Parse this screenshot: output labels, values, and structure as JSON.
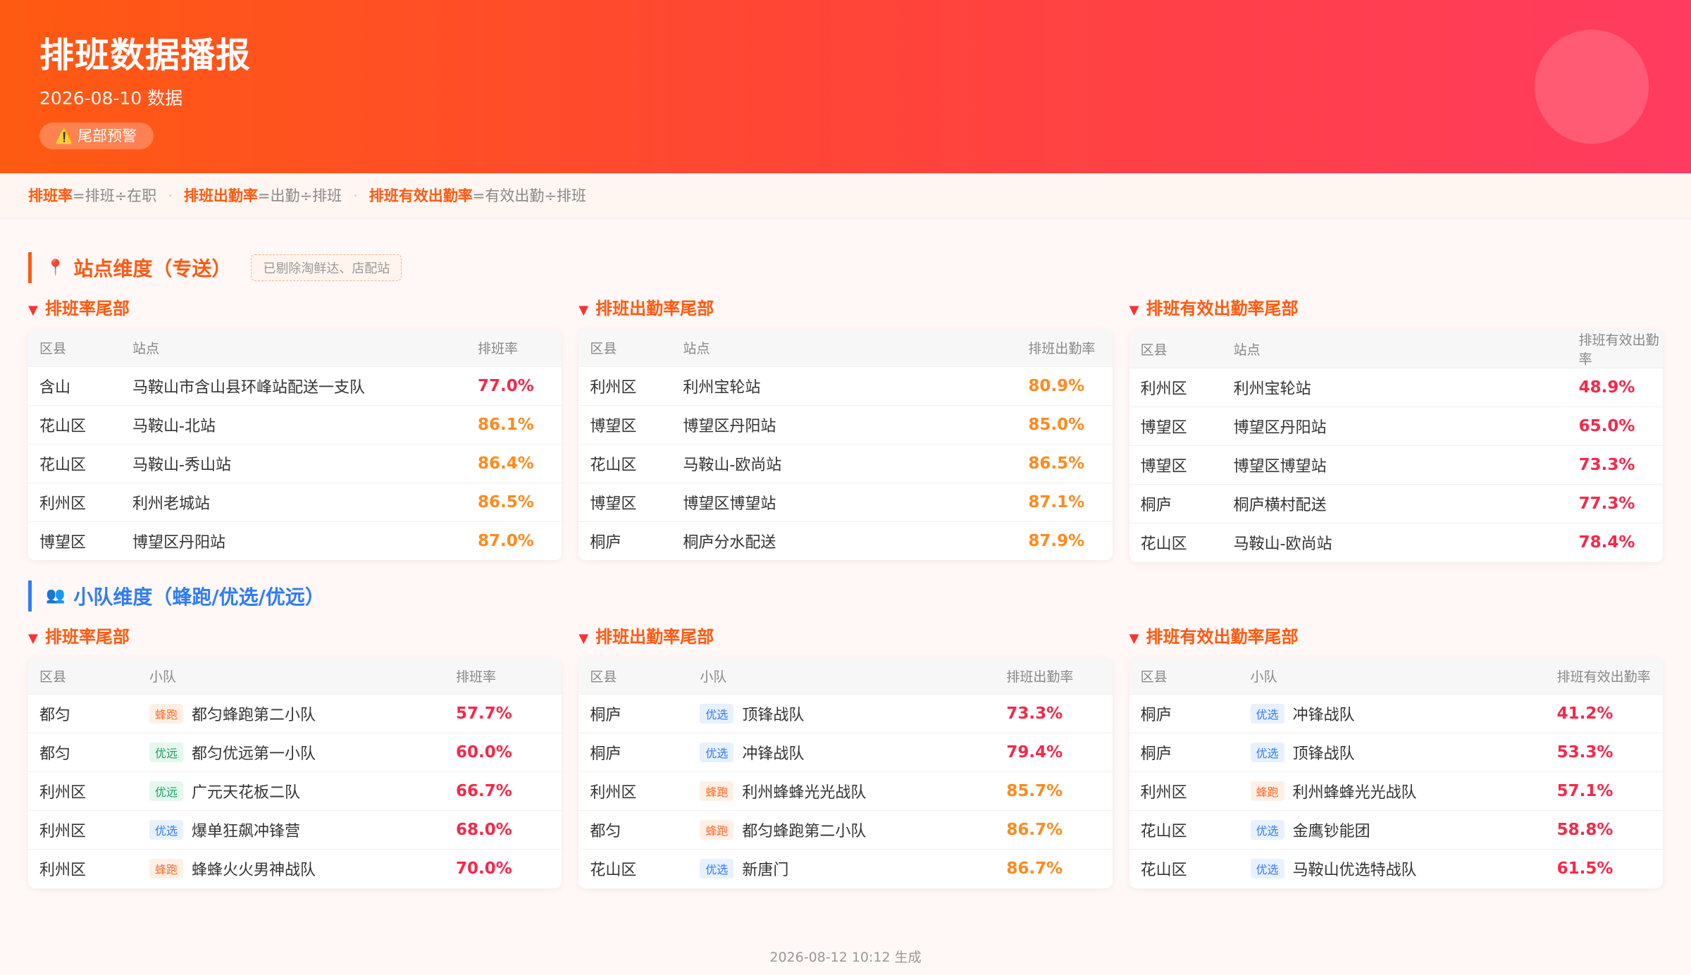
{
  "header": {
    "title": "排班数据播报",
    "date_line": "2026-08-10 数据",
    "warning_badge": "尾部预警"
  },
  "formula": [
    {
      "key": "排班率",
      "expr": "=排班÷在职"
    },
    {
      "key": "排班出勤率",
      "expr": "=出勤÷排班"
    },
    {
      "key": "排班有效出勤率",
      "expr": "=有效出勤÷排班"
    }
  ],
  "station_section": {
    "title": "站点维度（专送）",
    "tag": "已剔除淘鲜达、店配站",
    "tables": [
      {
        "title": "排班率尾部",
        "headers": [
          "区县",
          "站点",
          "排班率"
        ],
        "rows": [
          {
            "district": "含山",
            "name": "马鞍山市含山县环峰站配送一支队",
            "rate": "77.0%",
            "level": "red"
          },
          {
            "district": "花山区",
            "name": "马鞍山-北站",
            "rate": "86.1%",
            "level": "orange"
          },
          {
            "district": "花山区",
            "name": "马鞍山-秀山站",
            "rate": "86.4%",
            "level": "orange"
          },
          {
            "district": "利州区",
            "name": "利州老城站",
            "rate": "86.5%",
            "level": "orange"
          },
          {
            "district": "博望区",
            "name": "博望区丹阳站",
            "rate": "87.0%",
            "level": "orange"
          }
        ]
      },
      {
        "title": "排班出勤率尾部",
        "headers": [
          "区县",
          "站点",
          "排班出勤率"
        ],
        "rows": [
          {
            "district": "利州区",
            "name": "利州宝轮站",
            "rate": "80.9%",
            "level": "orange"
          },
          {
            "district": "博望区",
            "name": "博望区丹阳站",
            "rate": "85.0%",
            "level": "orange"
          },
          {
            "district": "花山区",
            "name": "马鞍山-欧尚站",
            "rate": "86.5%",
            "level": "orange"
          },
          {
            "district": "博望区",
            "name": "博望区博望站",
            "rate": "87.1%",
            "level": "orange"
          },
          {
            "district": "桐庐",
            "name": "桐庐分水配送",
            "rate": "87.9%",
            "level": "orange"
          }
        ]
      },
      {
        "title": "排班有效出勤率尾部",
        "headers": [
          "区县",
          "站点",
          "排班有效出勤率"
        ],
        "rows": [
          {
            "district": "利州区",
            "name": "利州宝轮站",
            "rate": "48.9%",
            "level": "red"
          },
          {
            "district": "博望区",
            "name": "博望区丹阳站",
            "rate": "65.0%",
            "level": "red"
          },
          {
            "district": "博望区",
            "name": "博望区博望站",
            "rate": "73.3%",
            "level": "red"
          },
          {
            "district": "桐庐",
            "name": "桐庐横村配送",
            "rate": "77.3%",
            "level": "red"
          },
          {
            "district": "花山区",
            "name": "马鞍山-欧尚站",
            "rate": "78.4%",
            "level": "red"
          }
        ]
      }
    ]
  },
  "team_section": {
    "title": "小队维度（蜂跑/优选/优远）",
    "tables": [
      {
        "title": "排班率尾部",
        "headers": [
          "区县",
          "小队",
          "排班率"
        ],
        "rows": [
          {
            "district": "都匀",
            "badge": "蜂跑",
            "btype": "feng",
            "name": "都匀蜂跑第二小队",
            "rate": "57.7%",
            "level": "red"
          },
          {
            "district": "都匀",
            "badge": "优远",
            "btype": "yy",
            "name": "都匀优远第一小队",
            "rate": "60.0%",
            "level": "red"
          },
          {
            "district": "利州区",
            "badge": "优远",
            "btype": "yy",
            "name": "广元天花板二队",
            "rate": "66.7%",
            "level": "red"
          },
          {
            "district": "利州区",
            "badge": "优选",
            "btype": "you",
            "name": "爆单狂飙冲锋营",
            "rate": "68.0%",
            "level": "red"
          },
          {
            "district": "利州区",
            "badge": "蜂跑",
            "btype": "feng",
            "name": "蜂蜂火火男神战队",
            "rate": "70.0%",
            "level": "red"
          }
        ]
      },
      {
        "title": "排班出勤率尾部",
        "headers": [
          "区县",
          "小队",
          "排班出勤率"
        ],
        "rows": [
          {
            "district": "桐庐",
            "badge": "优选",
            "btype": "you",
            "name": "顶锋战队",
            "rate": "73.3%",
            "level": "red"
          },
          {
            "district": "桐庐",
            "badge": "优选",
            "btype": "you",
            "name": "冲锋战队",
            "rate": "79.4%",
            "level": "red"
          },
          {
            "district": "利州区",
            "badge": "蜂跑",
            "btype": "feng",
            "name": "利州蜂蜂光光战队",
            "rate": "85.7%",
            "level": "orange"
          },
          {
            "district": "都匀",
            "badge": "蜂跑",
            "btype": "feng",
            "name": "都匀蜂跑第二小队",
            "rate": "86.7%",
            "level": "orange"
          },
          {
            "district": "花山区",
            "badge": "优选",
            "btype": "you",
            "name": "新唐门",
            "rate": "86.7%",
            "level": "orange"
          }
        ]
      },
      {
        "title": "排班有效出勤率尾部",
        "headers": [
          "区县",
          "小队",
          "排班有效出勤率"
        ],
        "rows": [
          {
            "district": "桐庐",
            "badge": "优选",
            "btype": "you",
            "name": "冲锋战队",
            "rate": "41.2%",
            "level": "red"
          },
          {
            "district": "桐庐",
            "badge": "优选",
            "btype": "you",
            "name": "顶锋战队",
            "rate": "53.3%",
            "level": "red"
          },
          {
            "district": "利州区",
            "badge": "蜂跑",
            "btype": "feng",
            "name": "利州蜂蜂光光战队",
            "rate": "57.1%",
            "level": "red"
          },
          {
            "district": "花山区",
            "badge": "优选",
            "btype": "you",
            "name": "金鹰钞能团",
            "rate": "58.8%",
            "level": "red"
          },
          {
            "district": "花山区",
            "badge": "优选",
            "btype": "you",
            "name": "马鞍山优选特战队",
            "rate": "61.5%",
            "level": "red"
          }
        ]
      }
    ]
  },
  "footer": "2026-08-12 10:12 生成"
}
